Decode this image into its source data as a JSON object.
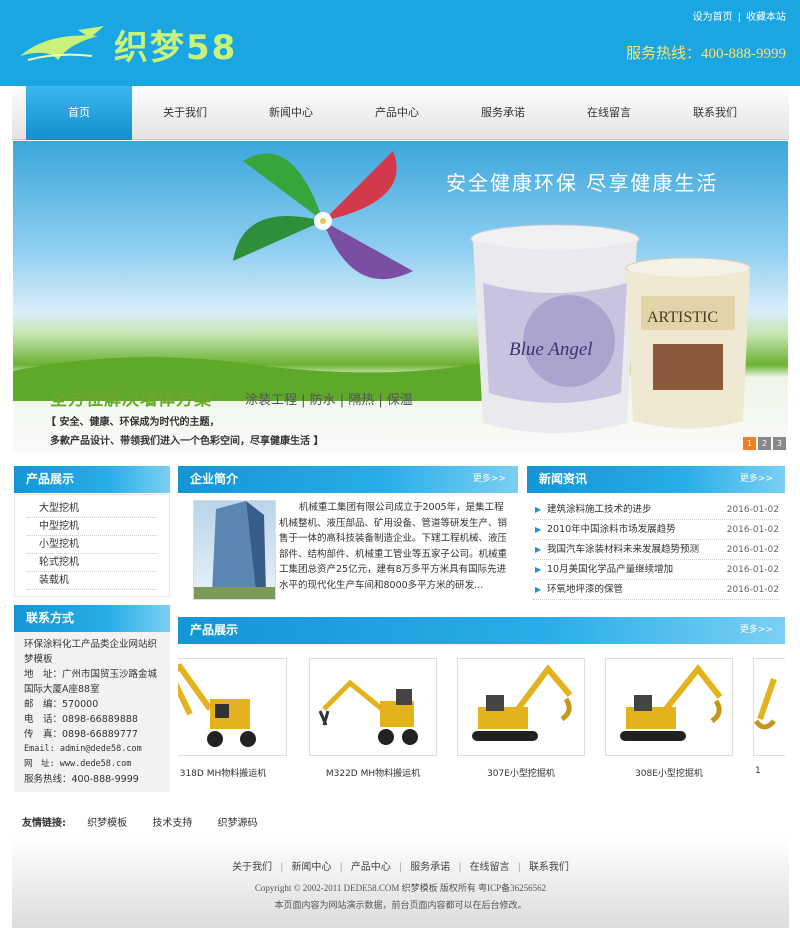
{
  "header": {
    "logo_text": "织梦58",
    "links": [
      "设为首页",
      "收藏本站"
    ],
    "hotline": "服务热线：400-888-9999"
  },
  "nav": {
    "items": [
      "首页",
      "关于我们",
      "新闻中心",
      "产品中心",
      "服务承诺",
      "在线留言",
      "联系我们"
    ],
    "active_index": 0
  },
  "banner": {
    "slogan": "安全健康环保  尽享健康生活",
    "headline": "全方位解决墙体方案",
    "headline2": "涂装工程 | 防水 | 隔热 | 保温",
    "sub1": "【 安全、健康、环保成为时代的主题，",
    "sub2": "多款产品设计、带领我们进入一个色彩空间，尽享健康生活 】",
    "bucket1_label": "Blue Angel",
    "bucket2_label": "ARTISTIC",
    "bucket2_small": "风格涂料",
    "slides": [
      "1",
      "2",
      "3"
    ],
    "active_slide": 0
  },
  "sidebar": {
    "products_title": "产品展示",
    "categories": [
      "大型挖机",
      "中型挖机",
      "小型挖机",
      "轮式挖机",
      "装载机"
    ],
    "contact_title": "联系方式",
    "contact_lines": [
      "环保涂料化工产品类企业网站织梦模板",
      "地　址：广州市国贸玉沙路金城国际大厦A座88室",
      "邮　编：570000",
      "电　话：0898-66889888",
      "传　真：0898-66889777",
      "Email: admin@dede58.com",
      "网　址: www.dede58.com",
      "服务热线：400-888-9999"
    ]
  },
  "intro": {
    "title": "企业简介",
    "more": "更多>>",
    "text": "机械重工集团有限公司成立于2005年，是集工程机械整机、液压部品、矿用设备、管道等研发生产、销售于一体的高科技装备制造企业。下辖工程机械、液压部件、结构部件、机械重工管业等五家子公司。机械重工集团总资产25亿元，建有8万多平方米具有国际先进水平的现代化生产车间和8000多平方米的研发..."
  },
  "news": {
    "title": "新闻资讯",
    "more": "更多>>",
    "items": [
      {
        "title": "建筑涂料施工技术的进步",
        "date": "2016-01-02"
      },
      {
        "title": "2010年中国涂料市场发展趋势",
        "date": "2016-01-02"
      },
      {
        "title": "我国汽车涂装材料未来发展趋势预测",
        "date": "2016-01-02"
      },
      {
        "title": "10月美国化学品产量继续增加",
        "date": "2016-01-02"
      },
      {
        "title": "环氧地坪漆的保管",
        "date": "2016-01-02"
      }
    ]
  },
  "products": {
    "title": "产品展示",
    "more": "更多>>",
    "items": [
      "318D MH物料搬运机",
      "M322D MH物料搬运机",
      "307E小型挖掘机",
      "308E小型挖掘机",
      "1"
    ]
  },
  "friends": {
    "label": "友情链接:",
    "links": [
      "织梦模板",
      "技术支持",
      "织梦源码"
    ]
  },
  "footer": {
    "nav": [
      "关于我们",
      "新闻中心",
      "产品中心",
      "服务承诺",
      "在线留言",
      "联系我们"
    ],
    "copyright": "Copyright © 2002-2011 DEDE58.COM 织梦模板 版权所有 粤ICP备36256562",
    "note": "本页面内容为网站演示数据，前台页面内容都可以在后台修改。"
  },
  "colors": {
    "brand_blue": "#1aa6e2",
    "logo_green": "#c9f27a",
    "hotline_yellow": "#ffe26b",
    "slide_active": "#f27e1f"
  }
}
